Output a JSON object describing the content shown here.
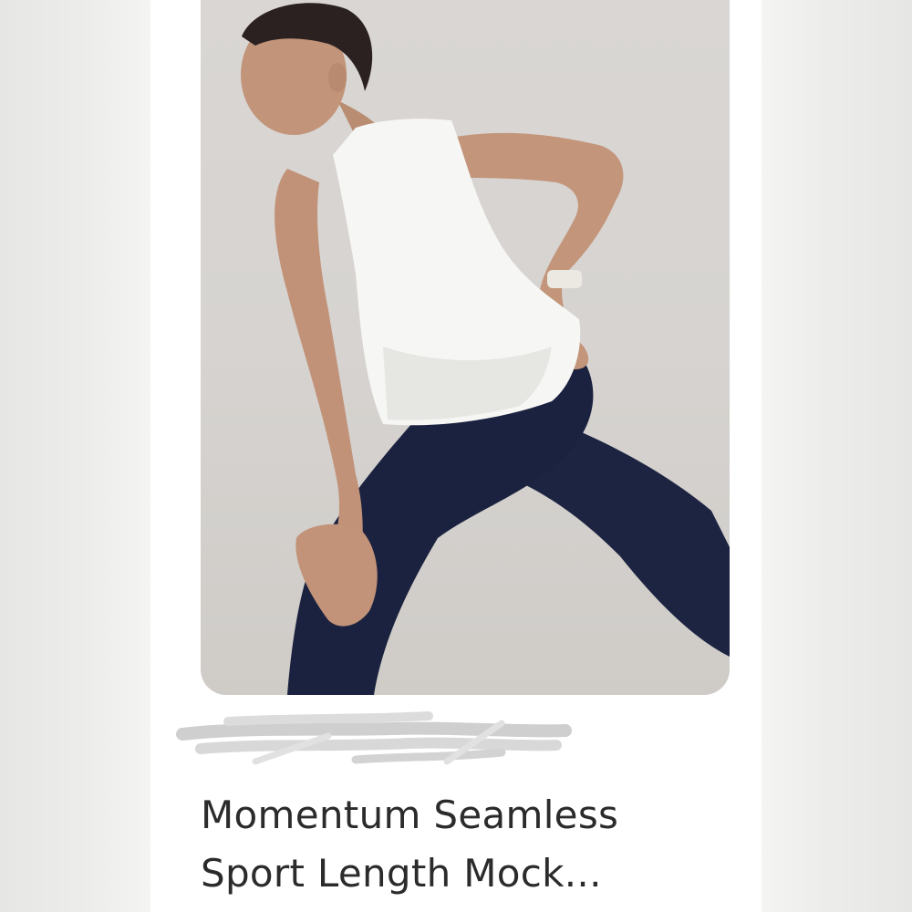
{
  "listing": {
    "image_alt": "Product photo",
    "title_line1": "Momentum Seamless",
    "title_line2": "Sport Length Mock..."
  },
  "colors": {
    "background": "#f1f1f0",
    "card": "#ffffff",
    "photo_background": "#d8d5d2",
    "title_text": "#2b2b2b",
    "leggings": "#1c2340",
    "tank_top": "#f7f7f5"
  }
}
